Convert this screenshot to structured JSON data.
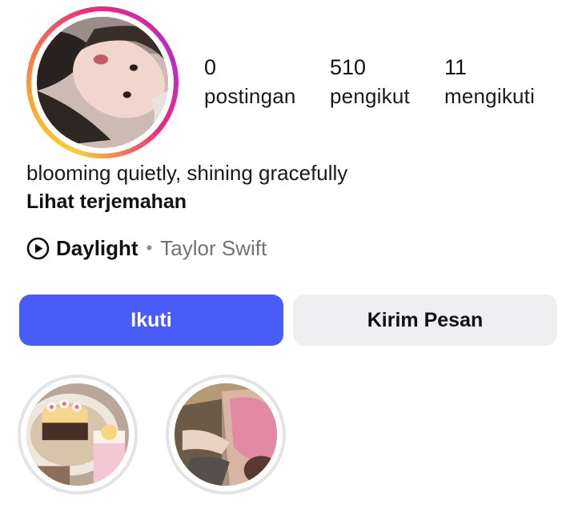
{
  "profile": {
    "avatar_icon": "profile-photo",
    "ring_colors": [
      "#f9ce34",
      "#ee2a7b",
      "#b72bcc"
    ]
  },
  "stats": {
    "posts": {
      "count": "0",
      "label": "postingan"
    },
    "followers": {
      "count": "510",
      "label": "pengikut"
    },
    "following": {
      "count": "11",
      "label": "mengikuti"
    }
  },
  "bio": {
    "text": "blooming quietly, shining gracefully",
    "translate_label": "Lihat terjemahan"
  },
  "music": {
    "icon": "play-circle-icon",
    "song": "Daylight",
    "separator": "•",
    "artist": "Taylor Swift"
  },
  "actions": {
    "follow_label": "Ikuti",
    "message_label": "Kirim Pesan",
    "accent": "#4a5cf7"
  },
  "highlights": [
    {
      "icon": "highlight-cake-photo"
    },
    {
      "icon": "highlight-person-photo"
    }
  ]
}
